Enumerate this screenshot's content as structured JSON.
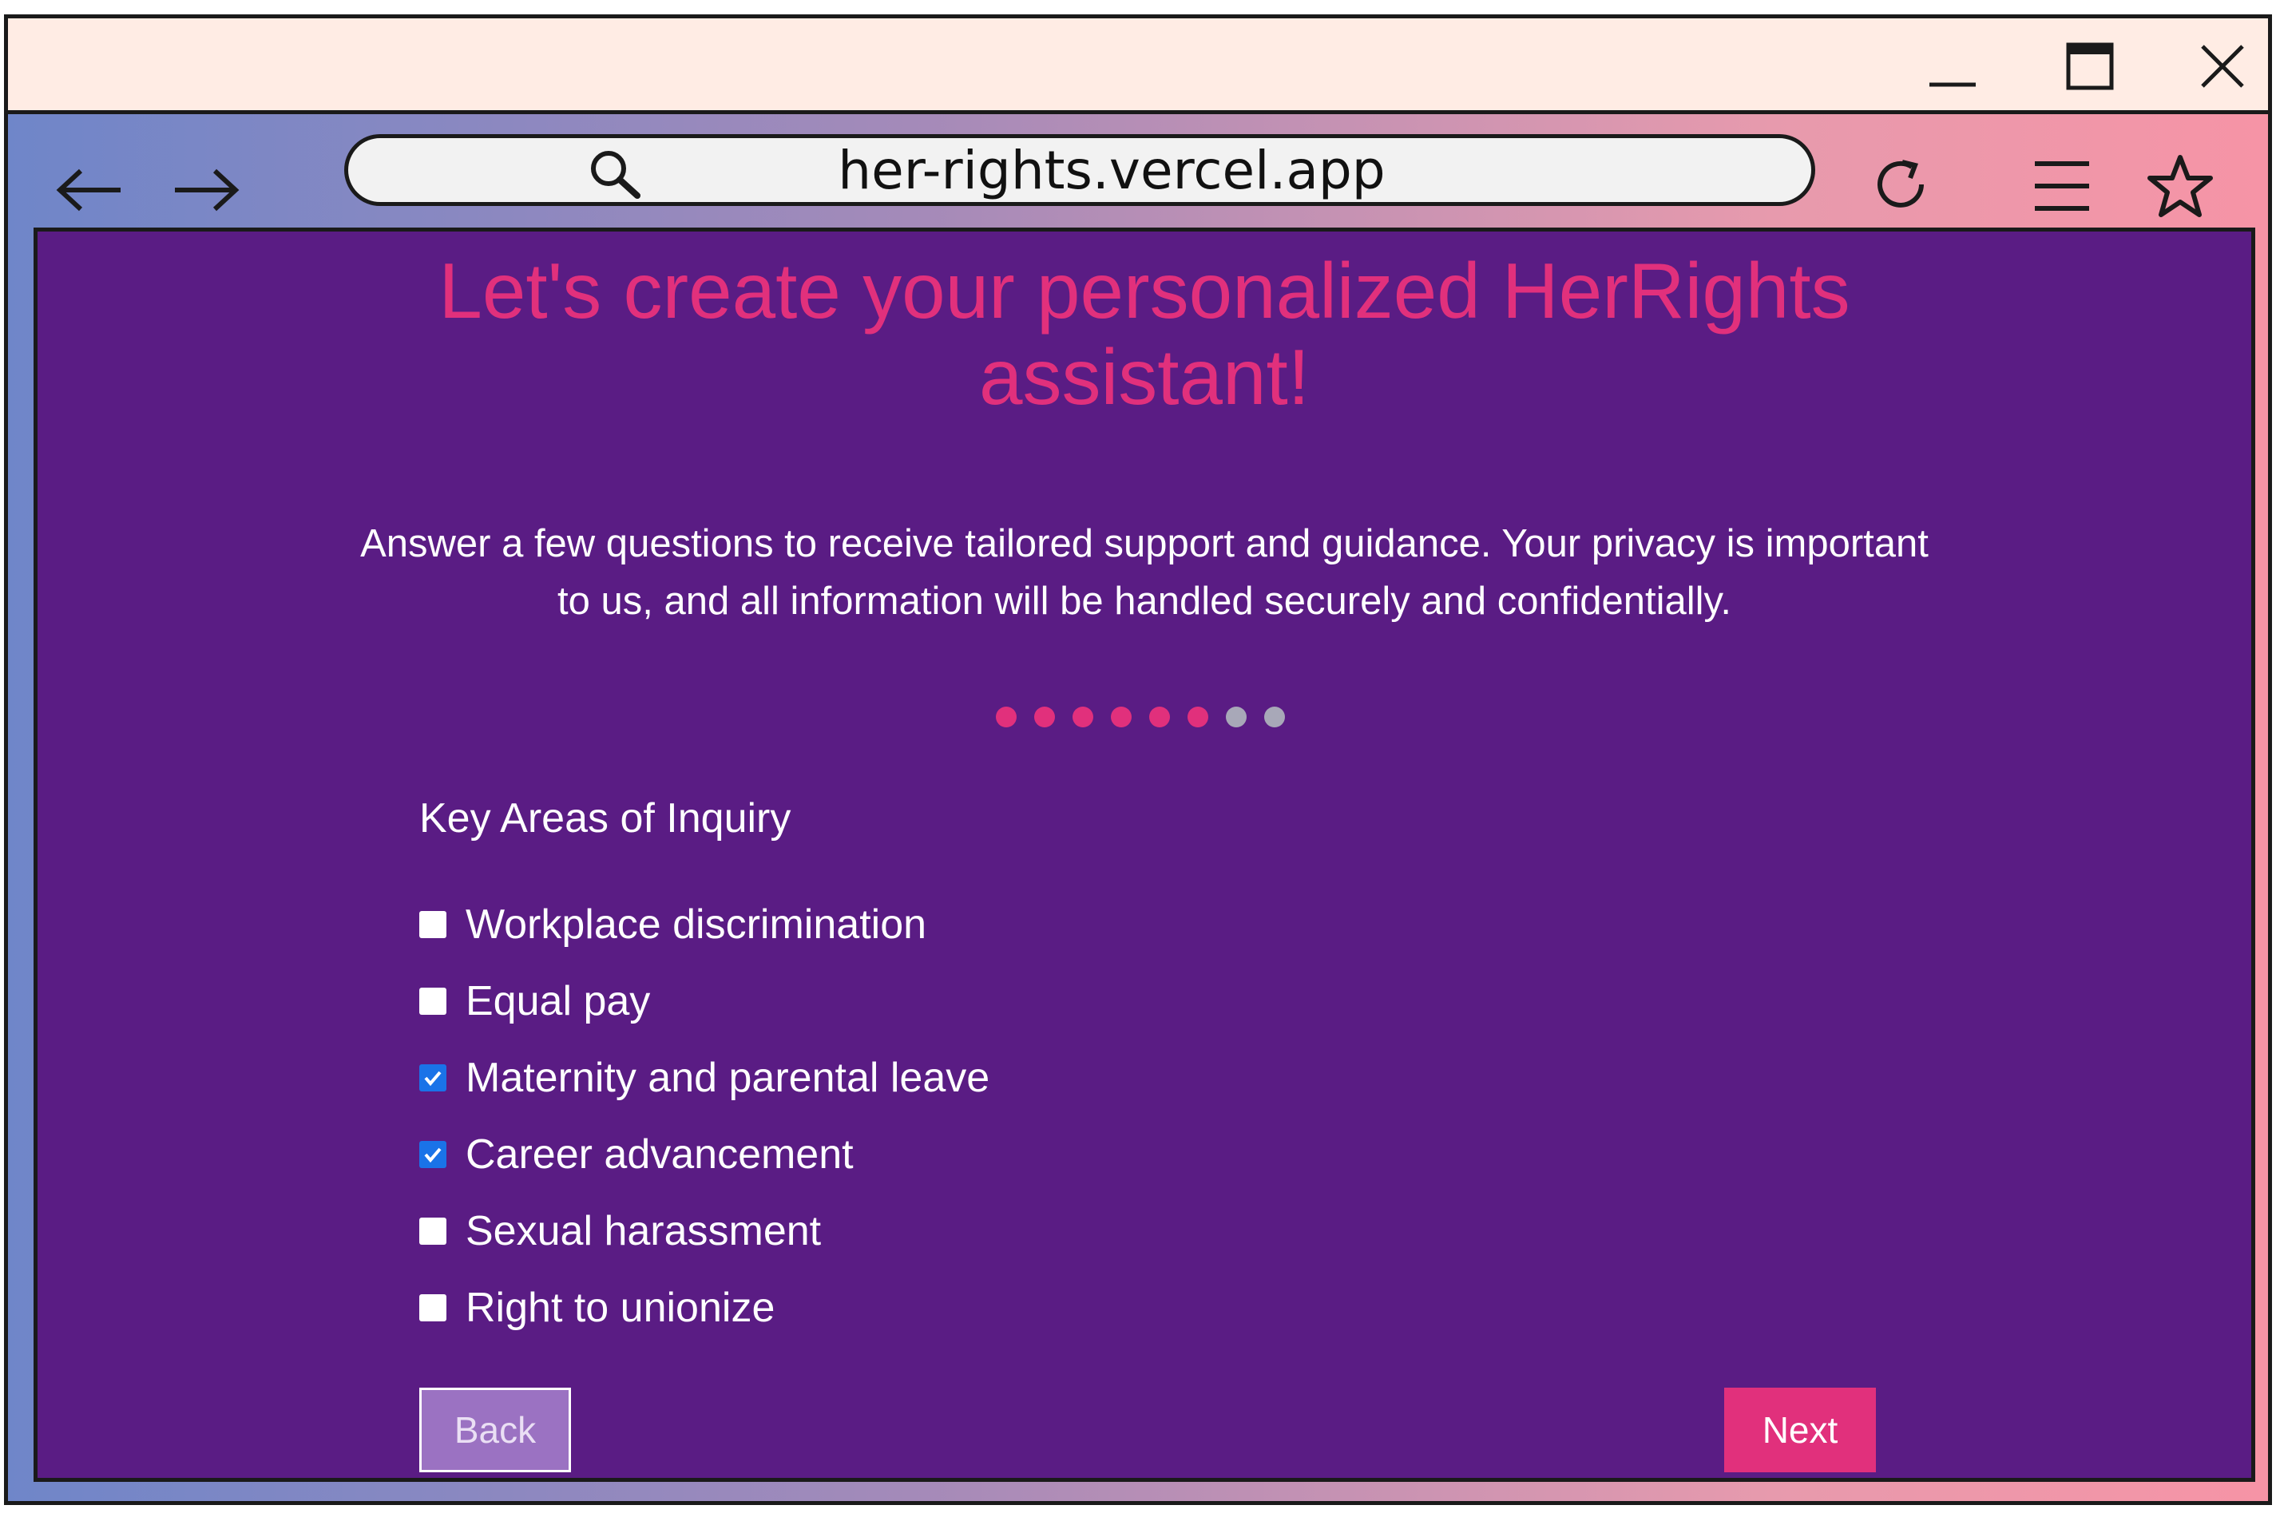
{
  "browser": {
    "url": "her-rights.vercel.app",
    "icons": {
      "minimize": "minimize-icon",
      "maximize": "maximize-icon",
      "close": "close-icon",
      "back": "arrow-left-icon",
      "forward": "arrow-right-icon",
      "search": "search-icon",
      "reload": "reload-icon",
      "menu": "hamburger-menu-icon",
      "bookmark": "star-icon"
    }
  },
  "page": {
    "title_line1": "Let's create your personalized HerRights",
    "title_line2": "assistant!",
    "subtitle": "Answer a few questions to receive tailored support and guidance. Your privacy is important to us, and all information will be handled securely and confidentially.",
    "progress": {
      "total_steps": 8,
      "completed_steps": 6
    },
    "section_heading": "Key Areas of Inquiry",
    "options": [
      {
        "label": "Workplace discrimination",
        "checked": false
      },
      {
        "label": "Equal pay",
        "checked": false
      },
      {
        "label": "Maternity and parental leave",
        "checked": true
      },
      {
        "label": "Career advancement",
        "checked": true
      },
      {
        "label": "Sexual harassment",
        "checked": false
      },
      {
        "label": "Right to unionize",
        "checked": false
      }
    ],
    "back_label": "Back",
    "next_label": "Next"
  },
  "colors": {
    "page_background": "#5a1c84",
    "accent": "#e1307c",
    "checkbox_checked": "#1a73e8",
    "back_button": "#9b72c2",
    "titlebar": "#ffece4"
  }
}
